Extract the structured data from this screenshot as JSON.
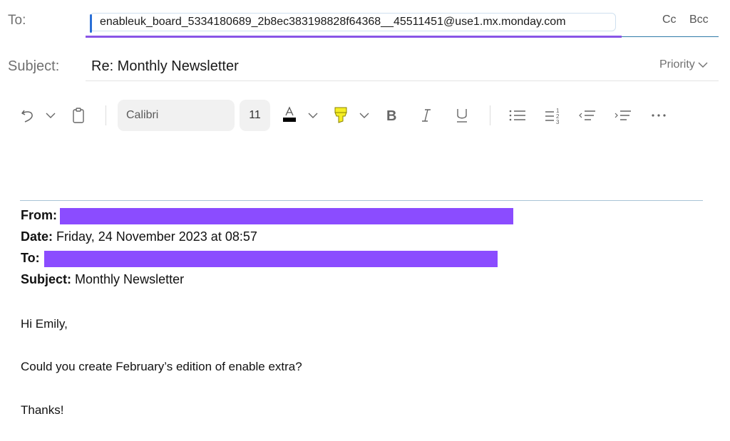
{
  "header": {
    "to_label": "To:",
    "to_recipient": "enableuk_board_5334180689_2b8ec383198828f64368__45511451@use1.mx.monday.com",
    "cc_label": "Cc",
    "bcc_label": "Bcc",
    "subject_label": "Subject:",
    "subject_value": "Re: Monthly Newsletter",
    "priority_label": "Priority"
  },
  "toolbar": {
    "font_name": "Calibri",
    "font_size": "11",
    "icons": [
      "undo-icon",
      "chevron-down-icon",
      "clipboard-icon",
      "font-color-icon",
      "chevron-down-icon",
      "highlighter-icon",
      "chevron-down-icon",
      "bold-icon",
      "italic-icon",
      "underline-icon",
      "bulleted-list-icon",
      "numbered-list-icon",
      "decrease-indent-icon",
      "increase-indent-icon",
      "more-icon"
    ],
    "font_color_swatch": "#000000",
    "highlight_color": "#f5ee25"
  },
  "quoted": {
    "from_label": "From:",
    "date_label": "Date:",
    "date_value": "Friday, 24 November 2023 at 08:57",
    "to_label": "To:",
    "subject_label": "Subject:",
    "subject_value": "Monthly Newsletter",
    "redaction_color": "#8b4cff"
  },
  "body": {
    "greeting": "Hi Emily,",
    "line1": "Could you create February’s edition of enable extra?",
    "signoff": "Thanks!"
  }
}
